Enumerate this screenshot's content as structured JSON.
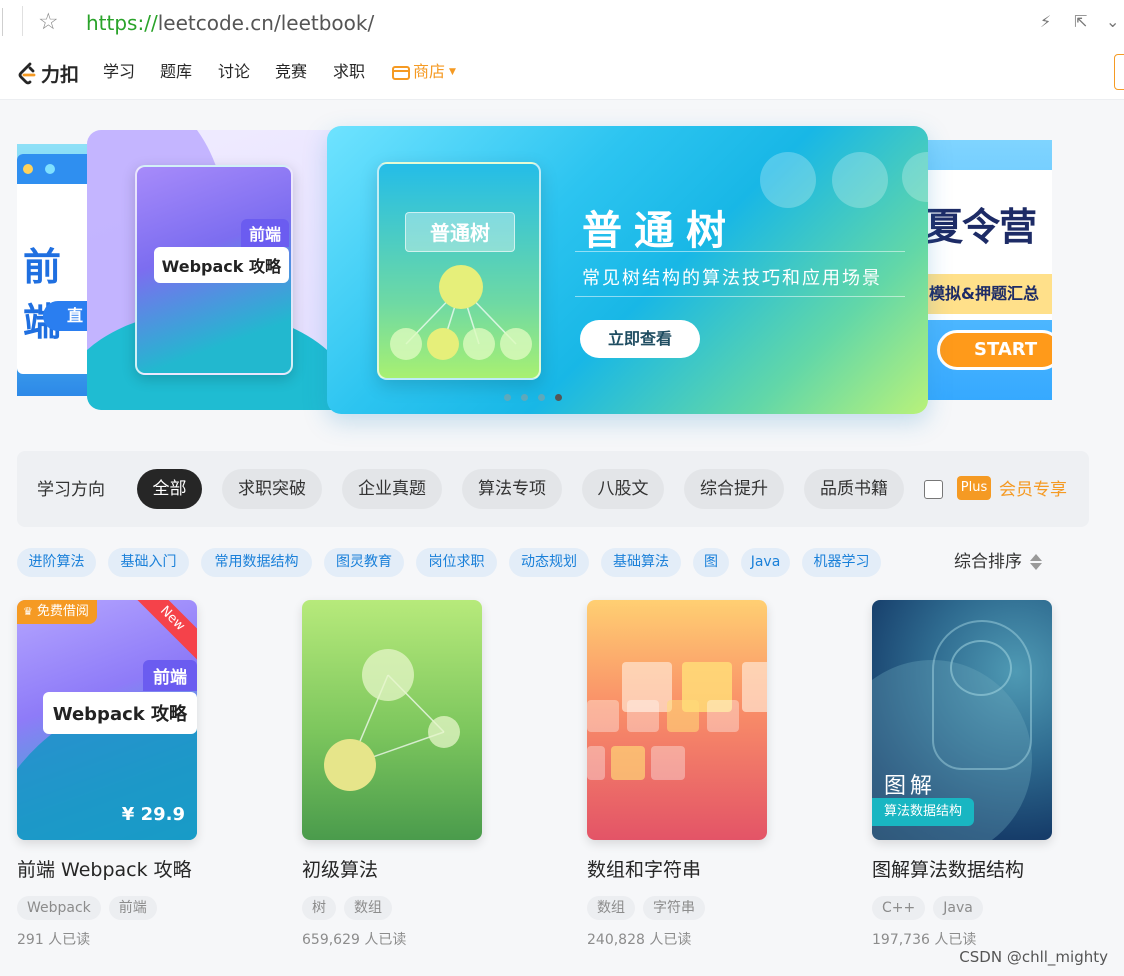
{
  "browser": {
    "url_protocol": "https://",
    "url_rest": "leetcode.cn/leetbook/"
  },
  "nav": {
    "logo_text": "力扣",
    "items": [
      "学习",
      "题库",
      "讨论",
      "竞赛",
      "求职"
    ],
    "shop_label": "商店"
  },
  "carousel": {
    "left_slide": {
      "title": "前端",
      "button": "直"
    },
    "mid_slide": {
      "tag": "前端",
      "title": "Webpack 攻略"
    },
    "main_slide": {
      "card_label": "普通树",
      "title": "普通树",
      "subtitle": "常见树结构的算法技巧和应用场景",
      "button": "立即查看"
    },
    "right_slide": {
      "title": "夏令营",
      "subtitle": "模拟&押题汇总",
      "button": "START"
    },
    "dot_count": 4,
    "active_dot": 3
  },
  "filter": {
    "label": "学习方向",
    "chips": [
      "全部",
      "求职突破",
      "企业真题",
      "算法专项",
      "八股文",
      "综合提升",
      "品质书籍"
    ],
    "active_index": 0,
    "plus_badge": "Plus",
    "member_label": "会员专享"
  },
  "tags": [
    "进阶算法",
    "基础入门",
    "常用数据结构",
    "图灵教育",
    "岗位求职",
    "动态规划",
    "基础算法",
    "图",
    "Java",
    "机器学习"
  ],
  "sort_label": "综合排序",
  "books": [
    {
      "title": "前端 Webpack 攻略",
      "tags": [
        "Webpack",
        "前端"
      ],
      "readers": "291 人已读",
      "cover": {
        "badge": "免费借阅",
        "corner": "New",
        "tag": "前端",
        "title": "Webpack 攻略",
        "price": "¥ 29.9"
      }
    },
    {
      "title": "初级算法",
      "tags": [
        "树",
        "数组"
      ],
      "readers": "659,629 人已读"
    },
    {
      "title": "数组和字符串",
      "tags": [
        "数组",
        "字符串"
      ],
      "readers": "240,828 人已读"
    },
    {
      "title": "图解算法数据结构",
      "tags": [
        "C++",
        "Java"
      ],
      "readers": "197,736 人已读",
      "cover": {
        "title": "图解",
        "subtitle": "算法数据结构"
      }
    }
  ],
  "watermark": "CSDN @chll_mighty",
  "colors": {
    "accent": "#f59a23",
    "tag_blue": "#1a80d9",
    "active_chip": "#262626"
  }
}
